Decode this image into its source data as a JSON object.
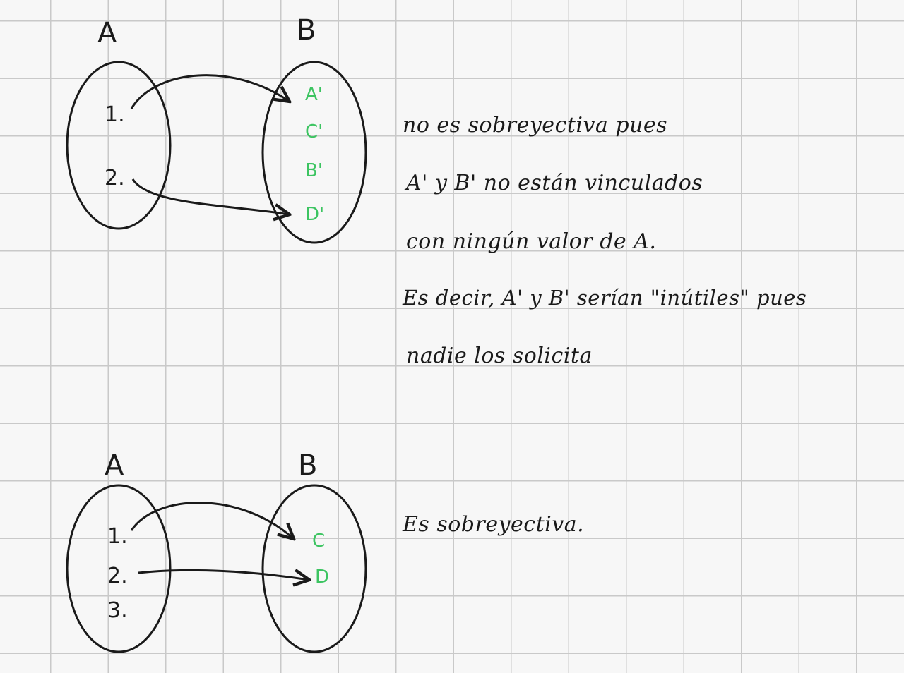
{
  "colors": {
    "ink": "#1a1a1a",
    "green": "#3cc461",
    "grid": "#c9c9c9",
    "paper": "#f7f7f7"
  },
  "diagram1": {
    "set_a_label": "A",
    "set_b_label": "B",
    "domain": [
      "1.",
      "2."
    ],
    "codomain": [
      "A'",
      "C'",
      "B'",
      "D'"
    ],
    "note_lines": [
      "no es sobreyectiva pues",
      "A' y B' no están vinculados",
      "con ningún valor de A.",
      "Es decir, A' y B' serían \"inútiles\" pues",
      "nadie los solicita"
    ]
  },
  "diagram2": {
    "set_a_label": "A",
    "set_b_label": "B",
    "domain": [
      "1.",
      "2.",
      "3."
    ],
    "codomain": [
      "C",
      "D"
    ],
    "note": "Es sobreyectiva."
  }
}
